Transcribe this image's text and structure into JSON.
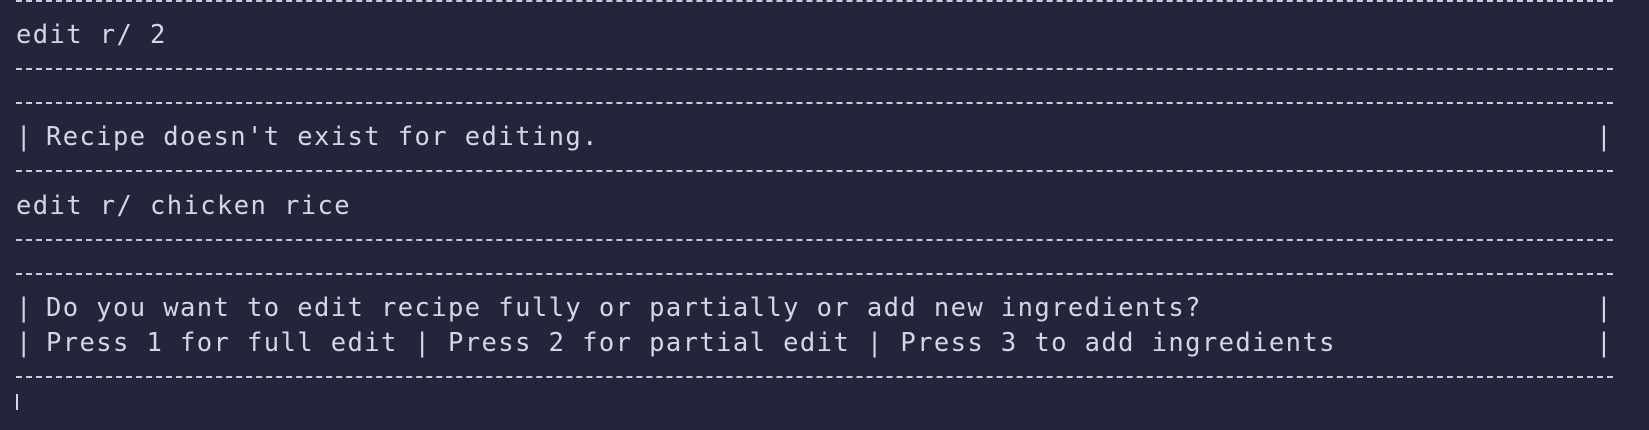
{
  "terminal": {
    "blocks": [
      {
        "command": "edit r/ 2",
        "messages": [
          "Recipe doesn't exist for editing."
        ]
      },
      {
        "command": "edit r/ chicken rice",
        "messages": [
          "Do you want to edit recipe fully or partially or add new ingredients?",
          "Press 1 for full edit | Press 2 for partial edit | Press 3 to add ingredients"
        ]
      }
    ],
    "border_char": "|"
  },
  "colors": {
    "background": "#23263a",
    "text": "#d4d6e4"
  }
}
